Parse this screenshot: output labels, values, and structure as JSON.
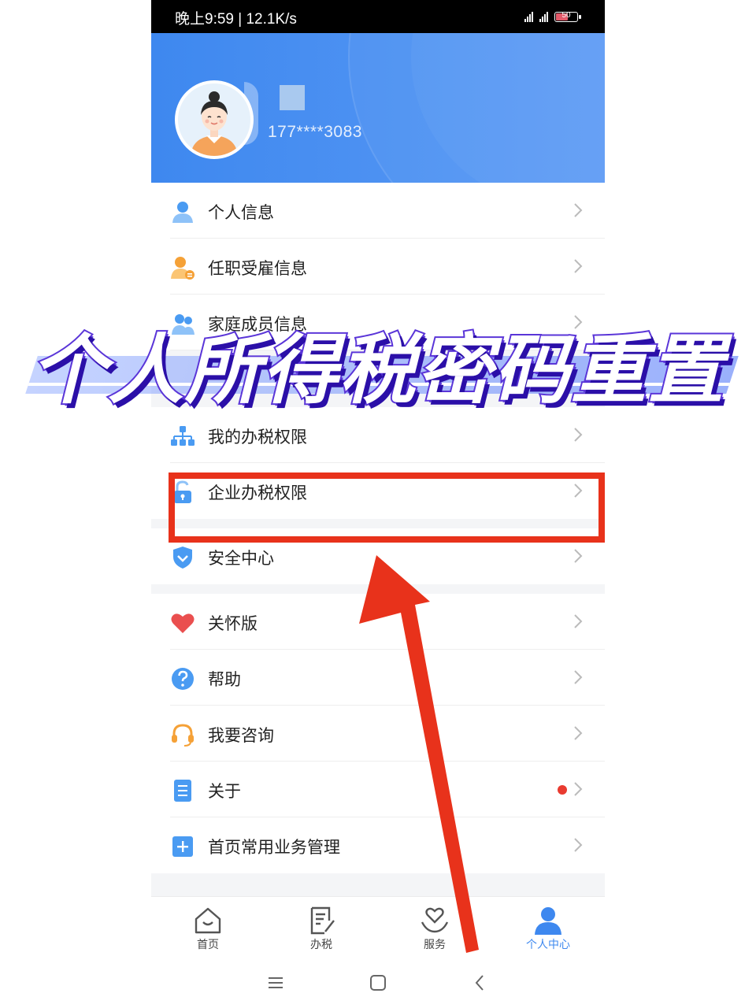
{
  "status_bar": {
    "time": "晚上9:59 | 12.1K/s",
    "battery": "50"
  },
  "profile": {
    "phone": "177****3083"
  },
  "menu": [
    {
      "label": "个人信息",
      "icon": "person-icon"
    },
    {
      "label": "任职受雇信息",
      "icon": "employment-icon"
    },
    {
      "label": "家庭成员信息",
      "icon": "family-icon"
    },
    {
      "label": "我的办税权限",
      "icon": "hierarchy-icon"
    },
    {
      "label": "企业办税权限",
      "icon": "unlock-icon"
    },
    {
      "label": "安全中心",
      "icon": "shield-icon"
    },
    {
      "label": "关怀版",
      "icon": "heart-icon"
    },
    {
      "label": "帮助",
      "icon": "help-icon"
    },
    {
      "label": "我要咨询",
      "icon": "headset-icon"
    },
    {
      "label": "关于",
      "icon": "document-icon",
      "badge_dot": true
    },
    {
      "label": "首页常用业务管理",
      "icon": "plus-icon"
    }
  ],
  "tabs": [
    {
      "label": "首页",
      "icon": "home-icon",
      "active": false
    },
    {
      "label": "办税",
      "icon": "tax-form-icon",
      "active": false
    },
    {
      "label": "服务",
      "icon": "service-heart-icon",
      "active": false
    },
    {
      "label": "个人中心",
      "icon": "user-icon",
      "active": true
    }
  ],
  "overlay": {
    "title": "个人所得税密码重置"
  },
  "colors": {
    "brand_blue": "#3e88ef",
    "highlight_red": "#e8321b",
    "title_purple": "#5a35d8"
  }
}
